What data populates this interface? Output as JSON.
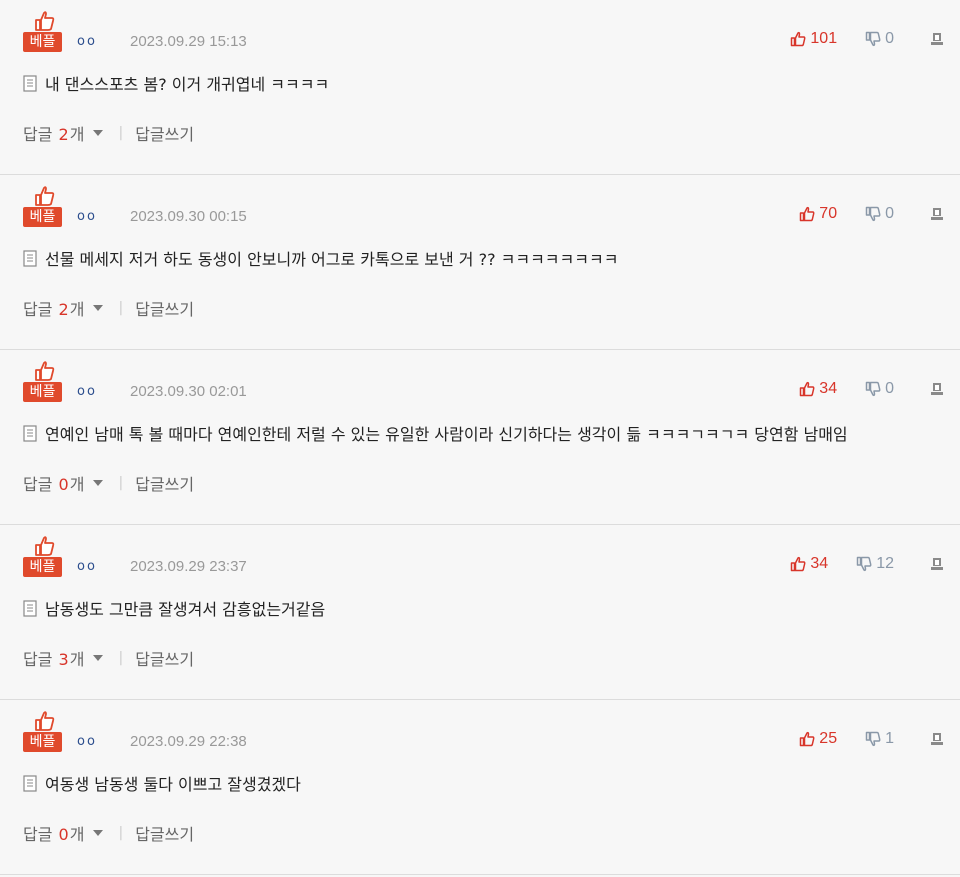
{
  "ui": {
    "best_label": "베플",
    "reply_prefix": "답글",
    "reply_suffix": "개",
    "write_reply": "답글쓰기"
  },
  "colors": {
    "accent_red": "#e04a2c",
    "upvote": "#d8352a",
    "downvote": "#8a98a8",
    "nickname": "#2d4f8e",
    "muted": "#999999"
  },
  "comments": [
    {
      "nick": "oo",
      "date": "2023.09.29 15:13",
      "up": "101",
      "down": "0",
      "text": "내 댄스스포츠 봄? 이거 개귀엽네 ㅋㅋㅋㅋ",
      "replies": "2"
    },
    {
      "nick": "oo",
      "date": "2023.09.30 00:15",
      "up": "70",
      "down": "0",
      "text": "선물 메세지 저거 하도 동생이 안보니까 어그로 카톡으로 보낸 거 ?? ㅋㅋㅋㅋㅋㅋㅋㅋ",
      "replies": "2"
    },
    {
      "nick": "oo",
      "date": "2023.09.30 02:01",
      "up": "34",
      "down": "0",
      "text": "연예인 남매 톡 볼 때마다 연예인한테 저럴 수 있는 유일한 사람이라 신기하다는 생각이 듦 ㅋㅋㅋㄱㅋㄱㅋ 당연함 남매임",
      "replies": "0"
    },
    {
      "nick": "oo",
      "date": "2023.09.29 23:37",
      "up": "34",
      "down": "12",
      "text": "남동생도 그만큼 잘생겨서 감흥없는거같음",
      "replies": "3"
    },
    {
      "nick": "oo",
      "date": "2023.09.29 22:38",
      "up": "25",
      "down": "1",
      "text": "여동생 남동생 둘다 이쁘고 잘생겼겠다",
      "replies": "0"
    }
  ]
}
